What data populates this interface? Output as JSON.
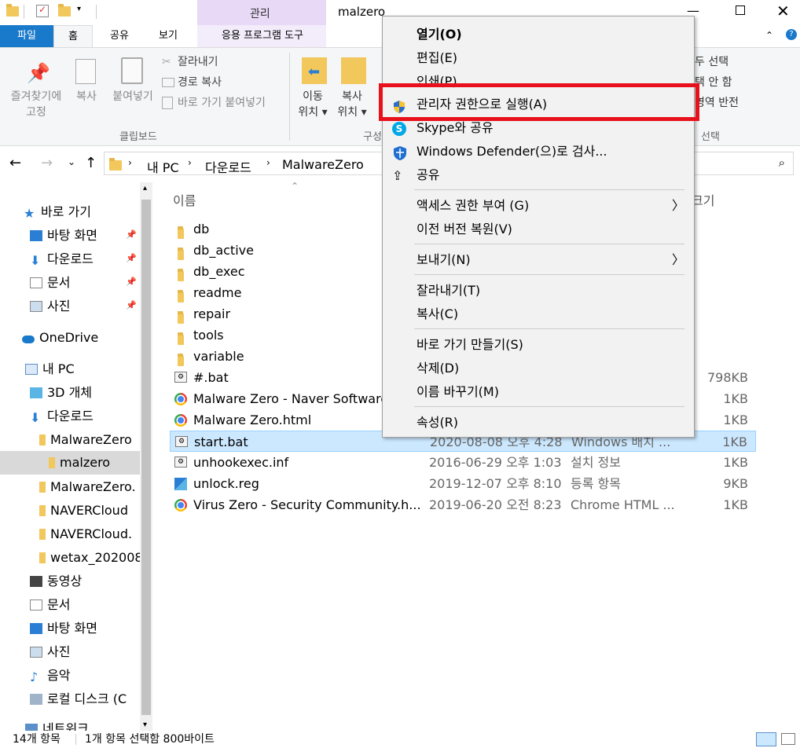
{
  "window": {
    "title": "malzero",
    "context_tab_label": "관리"
  },
  "ribbon_tabs": {
    "file": "파일",
    "home": "홈",
    "share": "공유",
    "view": "보기",
    "app_tools": "응용 프로그램 도구"
  },
  "ribbon": {
    "pin_label": "즐겨찾기에\n고정",
    "copy_label": "복사",
    "paste_label": "붙여넣기",
    "cut_label": "잘라내기",
    "copy_path_label": "경로 복사",
    "paste_shortcut_label": "바로 가기 붙여넣기",
    "clipboard_group": "클립보드",
    "move_to_label": "이동\n위치 ▾",
    "copy_to_label": "복사\n위치 ▾",
    "organize_group": "구성",
    "select_all": "두 선택",
    "select_none": "택 안 함",
    "invert_selection": "영역 반전",
    "select_group": "선택"
  },
  "address": {
    "crumbs": [
      "내 PC",
      "다운로드",
      "MalwareZero"
    ]
  },
  "nav": {
    "quick_access": "바로 가기",
    "desktop": "바탕 화면",
    "downloads": "다운로드",
    "documents": "문서",
    "pictures": "사진",
    "onedrive": "OneDrive",
    "this_pc": "내 PC",
    "objects3d": "3D 개체",
    "downloads2": "다운로드",
    "malwarezero": "MalwareZero",
    "malzero": "malzero",
    "malwarezero_zip": "MalwareZero.",
    "navercloud1": "NAVERCloud",
    "navercloud2": "NAVERCloud.",
    "wetax": "wetax_202008",
    "videos": "동영상",
    "documents2": "문서",
    "desktop2": "바탕 화면",
    "pictures2": "사진",
    "music": "음악",
    "local_disk": "로컬 디스크 (C",
    "network": "네트워크"
  },
  "columns": {
    "name": "이름",
    "size": "크기"
  },
  "files": [
    {
      "name": "db",
      "date": "",
      "type": "",
      "size": "",
      "icon": "folder-icon"
    },
    {
      "name": "db_active",
      "date": "",
      "type": "",
      "size": "",
      "icon": "folder-icon"
    },
    {
      "name": "db_exec",
      "date": "",
      "type": "",
      "size": "",
      "icon": "folder-icon"
    },
    {
      "name": "readme",
      "date": "",
      "type": "",
      "size": "",
      "icon": "folder-icon"
    },
    {
      "name": "repair",
      "date": "",
      "type": "",
      "size": "",
      "icon": "folder-icon"
    },
    {
      "name": "tools",
      "date": "",
      "type": "",
      "size": "",
      "icon": "folder-icon"
    },
    {
      "name": "variable",
      "date": "",
      "type": "",
      "size": "",
      "icon": "folder-icon"
    },
    {
      "name": "#.bat",
      "date": "",
      "type": "",
      "size": "798KB",
      "icon": "bat-icon"
    },
    {
      "name": "Malware Zero - Naver Software",
      "date": "",
      "type": "",
      "size": "1KB",
      "icon": "chrome-icon"
    },
    {
      "name": "Malware Zero.html",
      "date": "",
      "type": "",
      "size": "1KB",
      "icon": "chrome-icon"
    },
    {
      "name": "start.bat",
      "date": "2020-08-08 오후 4:28",
      "type": "Windows 배치 ...",
      "size": "1KB",
      "icon": "bat-icon"
    },
    {
      "name": "unhookexec.inf",
      "date": "2016-06-29 오후 1:03",
      "type": "설치 정보",
      "size": "1KB",
      "icon": "inf-icon"
    },
    {
      "name": "unlock.reg",
      "date": "2019-12-07 오후 8:10",
      "type": "등록 항목",
      "size": "9KB",
      "icon": "reg-icon"
    },
    {
      "name": "Virus Zero - Security Community.h...",
      "date": "2019-06-20 오전 8:23",
      "type": "Chrome HTML ...",
      "size": "1KB",
      "icon": "chrome-icon"
    }
  ],
  "context_menu": {
    "open": "열기(O)",
    "edit": "편집(E)",
    "print": "인쇄(P)",
    "run_as_admin": "관리자 권한으로 실행(A)",
    "skype_share": "Skype와 공유",
    "defender_scan": "Windows Defender(으)로 검사...",
    "share": "공유",
    "give_access": "액세스 권한 부여 (G)",
    "restore_versions": "이전 버전 복원(V)",
    "send_to": "보내기(N)",
    "cut": "잘라내기(T)",
    "copy": "복사(C)",
    "create_shortcut": "바로 가기 만들기(S)",
    "delete": "삭제(D)",
    "rename": "이름 바꾸기(M)",
    "properties": "속성(R)"
  },
  "status": {
    "item_count": "14개 항목",
    "selection": "1개 항목 선택함 800바이트"
  },
  "colors": {
    "file_tab": "#1979ca",
    "context_tab": "#e8d9f7",
    "selection": "#cce8ff",
    "highlight_box": "#e8101a"
  }
}
